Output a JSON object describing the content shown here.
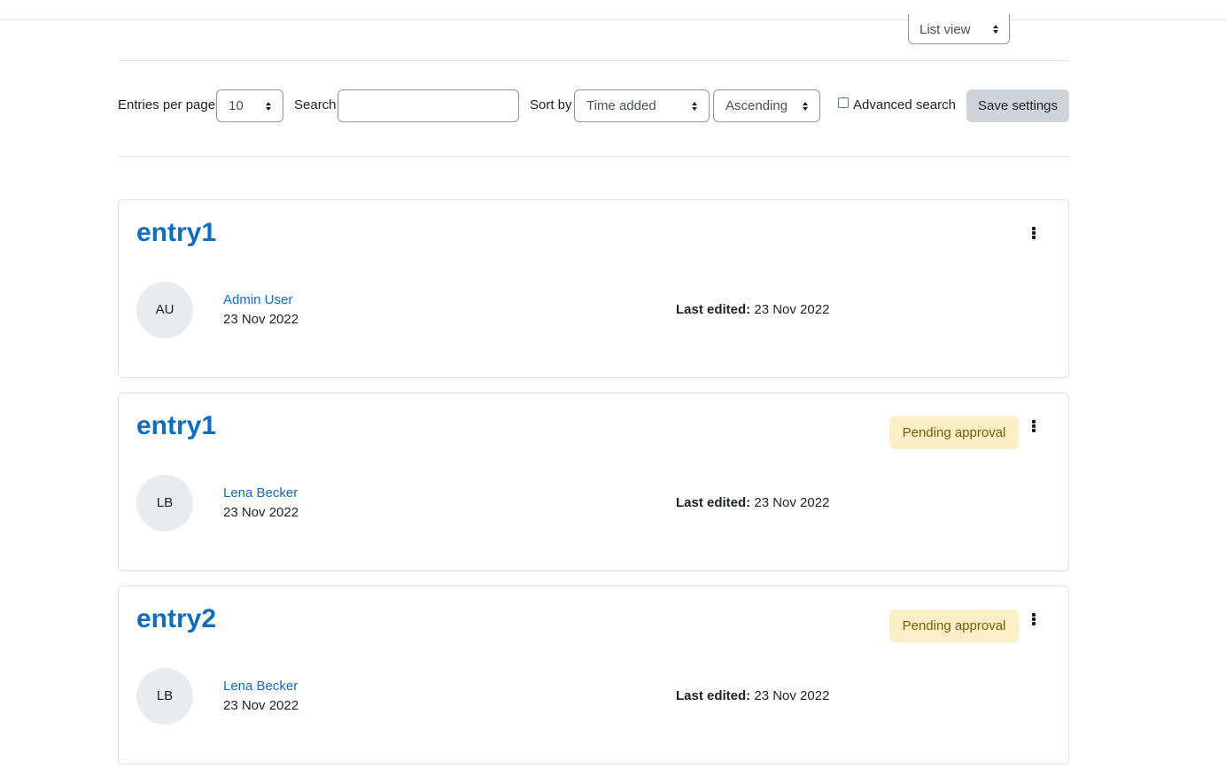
{
  "view_select": {
    "value": "List view"
  },
  "toolbar": {
    "entries_label": "Entries per page",
    "entries_value": "10",
    "search_label": "Search",
    "search_value": "",
    "sort_label": "Sort by",
    "sort_value": "Time added",
    "order_value": "Ascending",
    "advanced_label": "Advanced search",
    "advanced_checked": false,
    "save_label": "Save settings"
  },
  "entries": [
    {
      "title": "entry1",
      "badge": "",
      "avatar": "AU",
      "author": "Admin User",
      "created": "23 Nov 2022",
      "edited_label": "Last edited:",
      "edited_value": "23 Nov 2022"
    },
    {
      "title": "entry1",
      "badge": "Pending approval",
      "avatar": "LB",
      "author": "Lena Becker",
      "created": "23 Nov 2022",
      "edited_label": "Last edited:",
      "edited_value": "23 Nov 2022"
    },
    {
      "title": "entry2",
      "badge": "Pending approval",
      "avatar": "LB",
      "author": "Lena Becker",
      "created": "23 Nov 2022",
      "edited_label": "Last edited:",
      "edited_value": "23 Nov 2022"
    }
  ],
  "colors": {
    "link": "#0f6cbf",
    "badge_bg": "#fcefc7",
    "badge_text": "#7d5a05",
    "button_bg": "#ced4da"
  }
}
